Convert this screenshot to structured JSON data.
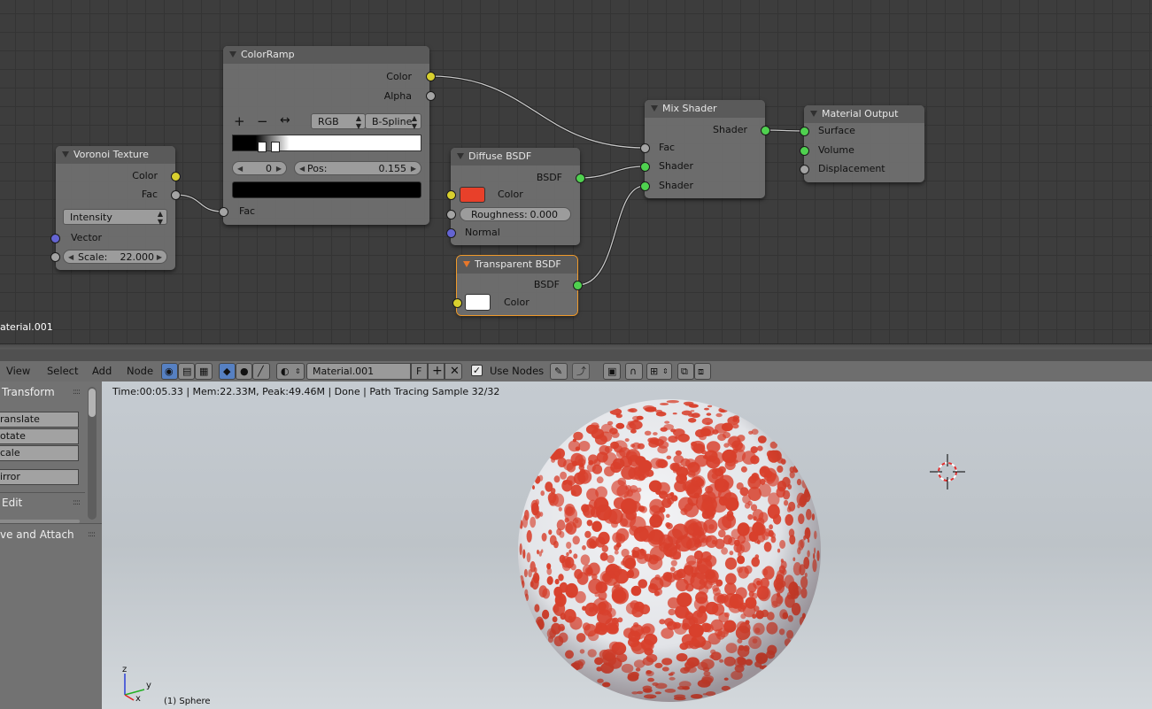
{
  "node_editor": {
    "material_name": "aterial.001",
    "nodes": {
      "colorramp": {
        "title": "ColorRamp",
        "out_color": "Color",
        "out_alpha": "Alpha",
        "add_btn": "+",
        "remove_btn": "−",
        "flip_btn": "↔",
        "color_mode": "RGB",
        "interpolation": "B-Spline",
        "stop_index": "0",
        "pos_label": "Pos:",
        "pos_value": "0.155",
        "stop_color": "#000000",
        "in_fac": "Fac"
      },
      "voronoi": {
        "title": "Voronoi Texture",
        "out_color": "Color",
        "out_fac": "Fac",
        "coloring": "Intensity",
        "in_vector": "Vector",
        "scale_label": "Scale:",
        "scale_value": "22.000"
      },
      "diffuse": {
        "title": "Diffuse BSDF",
        "out_bsdf": "BSDF",
        "in_color": "Color",
        "color_value": "#e8402a",
        "roughness_label": "Roughness:",
        "roughness_value": "0.000",
        "in_normal": "Normal"
      },
      "transparent": {
        "title": "Transparent BSDF",
        "out_bsdf": "BSDF",
        "in_color": "Color",
        "color_value": "#ffffff"
      },
      "mix": {
        "title": "Mix Shader",
        "out_shader": "Shader",
        "in_fac": "Fac",
        "in_shader1": "Shader",
        "in_shader2": "Shader"
      },
      "output": {
        "title": "Material Output",
        "in_surface": "Surface",
        "in_volume": "Volume",
        "in_displacement": "Displacement"
      }
    }
  },
  "header": {
    "menu": [
      "View",
      "Select",
      "Add",
      "Node"
    ],
    "material_field": "Material.001",
    "fake_user": "F",
    "use_nodes_label": "Use Nodes",
    "use_nodes_checked": "✓"
  },
  "toolshelf": {
    "transform_title": "Transform",
    "buttons": [
      "ranslate",
      "otate",
      "cale"
    ],
    "mirror": "irror",
    "edit_title": "Edit",
    "attach_title": "ve and Attach"
  },
  "viewport": {
    "render_info": "Time:00:05.33 | Mem:22.33M, Peak:49.46M | Done | Path Tracing Sample 32/32",
    "object_label": "(1) Sphere",
    "axis_z": "z",
    "axis_y": "y",
    "axis_x": "x"
  },
  "colors": {
    "sphere_spots": "#d8402c",
    "accent_active": "#f09a2a",
    "socket_shader": "#4fd14f",
    "socket_color": "#d8d02e",
    "socket_vector": "#6464d2"
  }
}
